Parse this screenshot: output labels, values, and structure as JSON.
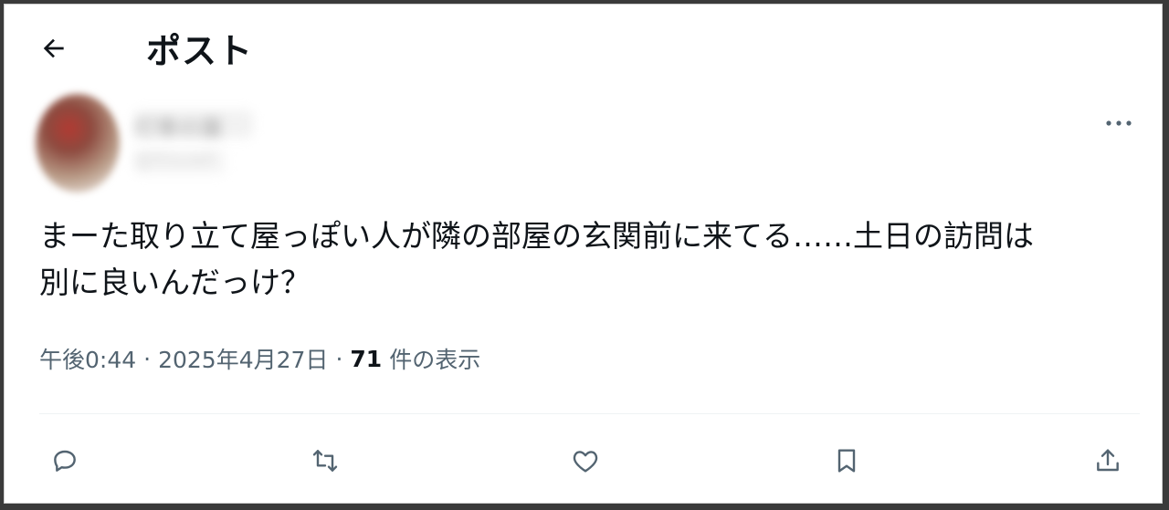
{
  "header": {
    "title": "ポスト",
    "back_icon": "arrow-left-icon"
  },
  "post": {
    "author": {
      "name": "灯青の蓮",
      "handle": "@ihsuwh"
    },
    "text_line1": "まーた取り立て屋っぽい人が隣の部屋の玄関前に来てる……土日の訪問は",
    "text_line2": "別に良いんだっけ？",
    "time": "午後0:44",
    "separator": "·",
    "date": "2025年4月27日",
    "views_count": "71",
    "views_label": "件の表示"
  },
  "actions": {
    "icons": [
      "reply-icon",
      "repost-icon",
      "like-icon",
      "bookmark-icon",
      "share-icon"
    ]
  },
  "colors": {
    "text_primary": "#0f1419",
    "text_secondary": "#536471",
    "divider": "#eff3f4"
  }
}
